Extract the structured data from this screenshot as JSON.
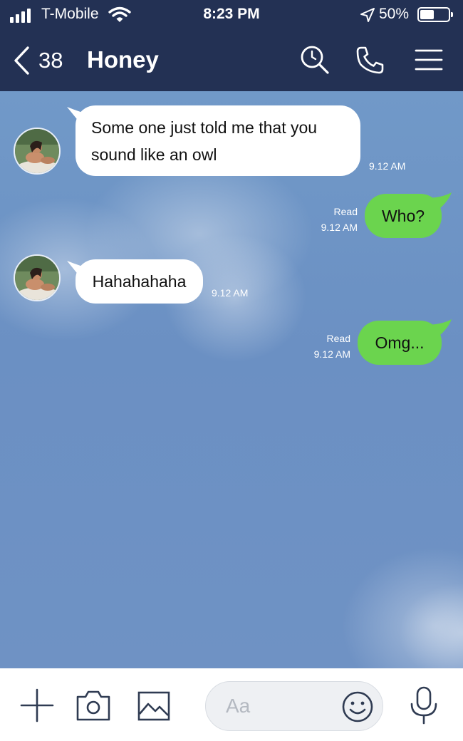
{
  "status_bar": {
    "carrier": "T-Mobile",
    "time": "8:23 PM",
    "battery": "50%",
    "battery_level": 0.5
  },
  "header": {
    "back_count": "38",
    "title": "Honey",
    "icons": [
      "search-icon",
      "phone-icon",
      "menu-icon"
    ]
  },
  "messages": [
    {
      "direction": "incoming",
      "lines": [
        "Some one just told me that you",
        "sound like an owl"
      ],
      "time": "9.12 AM"
    },
    {
      "direction": "outgoing",
      "text": "Who?",
      "read": "Read",
      "time": "9.12 AM"
    },
    {
      "direction": "incoming",
      "text": "Hahahahaha",
      "time": "9.12 AM"
    },
    {
      "direction": "outgoing",
      "text": "Omg...",
      "read": "Read",
      "time": "9.12 AM"
    }
  ],
  "composer": {
    "placeholder": "Aa",
    "icons": [
      "plus-icon",
      "camera-icon",
      "image-icon",
      "emoji-icon",
      "microphone-icon"
    ]
  },
  "colors": {
    "header_bg": "#233154",
    "chat_bg": "#7199c8",
    "outgoing_bubble": "#6bd44e",
    "incoming_bubble": "#ffffff"
  }
}
